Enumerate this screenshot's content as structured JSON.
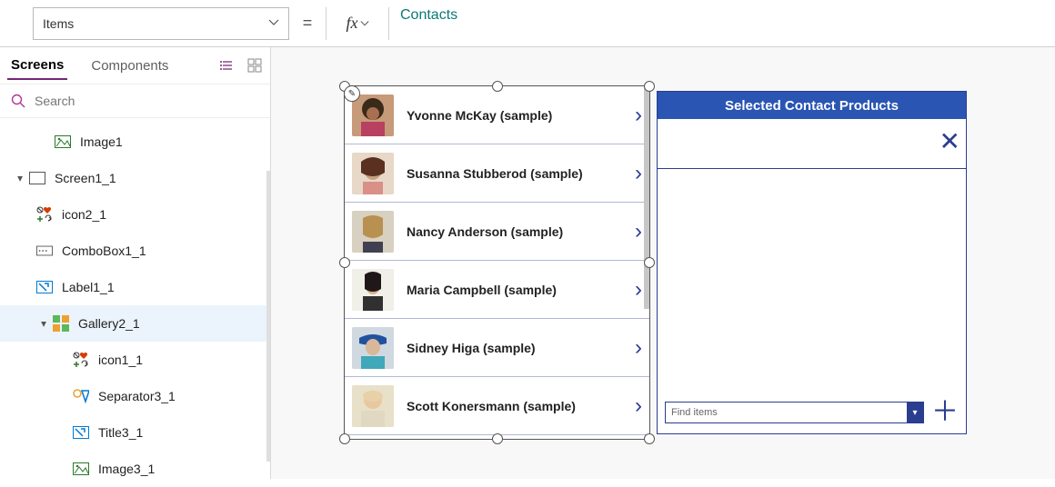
{
  "propSelector": {
    "value": "Items"
  },
  "formula": {
    "value": "Contacts"
  },
  "tabs": {
    "screens": "Screens",
    "components": "Components"
  },
  "search": {
    "placeholder": "Search"
  },
  "tree": {
    "image1": "Image1",
    "screen1": "Screen1_1",
    "icon2": "icon2_1",
    "combobox1": "ComboBox1_1",
    "label1": "Label1_1",
    "gallery2": "Gallery2_1",
    "icon1": "icon1_1",
    "separator3": "Separator3_1",
    "title3": "Title3_1",
    "image3": "Image3_1"
  },
  "contacts": [
    "Yvonne McKay (sample)",
    "Susanna Stubberod (sample)",
    "Nancy Anderson (sample)",
    "Maria Campbell (sample)",
    "Sidney Higa (sample)",
    "Scott Konersmann (sample)"
  ],
  "card": {
    "title": "Selected Contact Products",
    "findPlaceholder": "Find items"
  }
}
